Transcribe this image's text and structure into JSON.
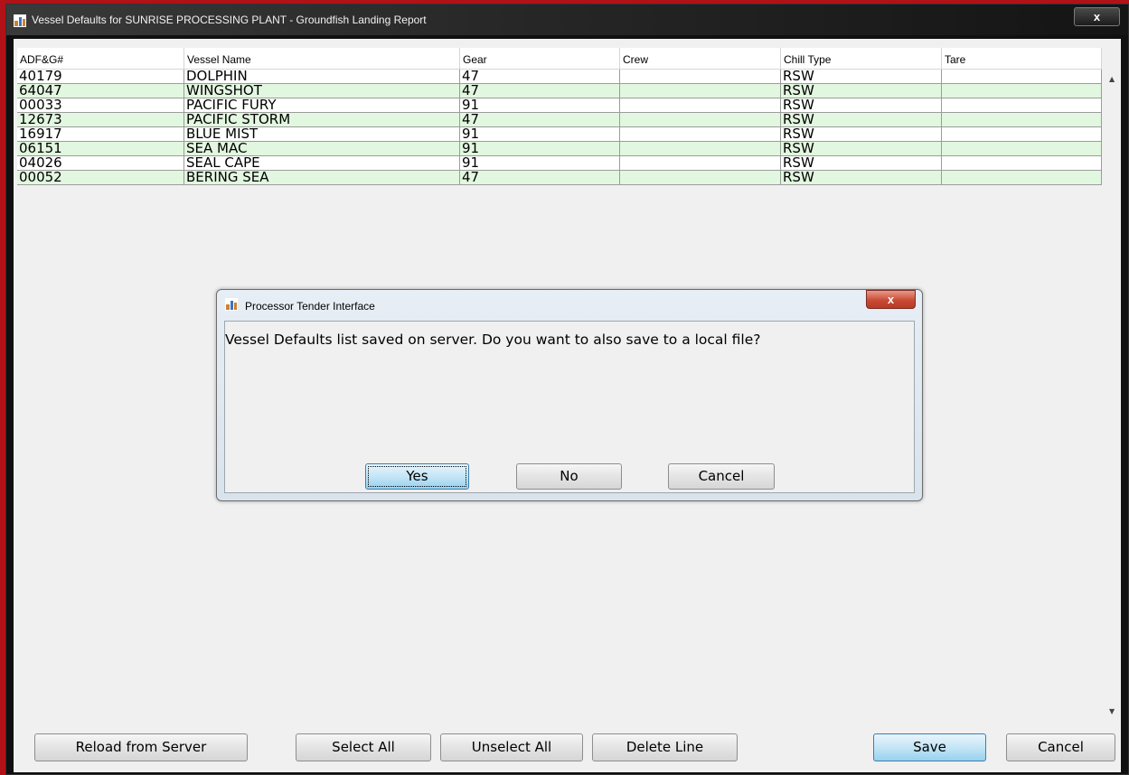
{
  "window": {
    "title": "Vessel Defaults for SUNRISE PROCESSING PLANT - Groundfish Landing Report",
    "close_label": "x"
  },
  "table": {
    "columns": [
      "ADF&G#",
      "Vessel Name",
      "Gear",
      "Crew",
      "Chill Type",
      "Tare"
    ],
    "rows": [
      [
        "40179",
        "DOLPHIN",
        "47",
        "",
        "RSW",
        ""
      ],
      [
        "64047",
        "WINGSHOT",
        "47",
        "",
        "RSW",
        ""
      ],
      [
        "00033",
        "PACIFIC FURY",
        "91",
        "",
        "RSW",
        ""
      ],
      [
        "12673",
        "PACIFIC STORM",
        "47",
        "",
        "RSW",
        ""
      ],
      [
        "16917",
        "BLUE MIST",
        "91",
        "",
        "RSW",
        ""
      ],
      [
        "06151",
        "SEA MAC",
        "91",
        "",
        "RSW",
        ""
      ],
      [
        "04026",
        "SEAL CAPE",
        "91",
        "",
        "RSW",
        ""
      ],
      [
        "00052",
        "BERING SEA",
        "47",
        "",
        "RSW",
        ""
      ]
    ]
  },
  "buttons": {
    "reload": "Reload from Server",
    "select_all": "Select All",
    "unselect_all": "Unselect All",
    "delete_line": "Delete Line",
    "save": "Save",
    "cancel": "Cancel"
  },
  "dialog": {
    "title": "Processor Tender Interface",
    "close_label": "x",
    "message": "Vessel Defaults list saved on server. Do you want to also save to a local file?",
    "yes": "Yes",
    "no": "No",
    "cancel": "Cancel"
  },
  "colors": {
    "row_alt": "#e2f7df",
    "row": "#ffffff",
    "frame_accent": "#b01218"
  }
}
